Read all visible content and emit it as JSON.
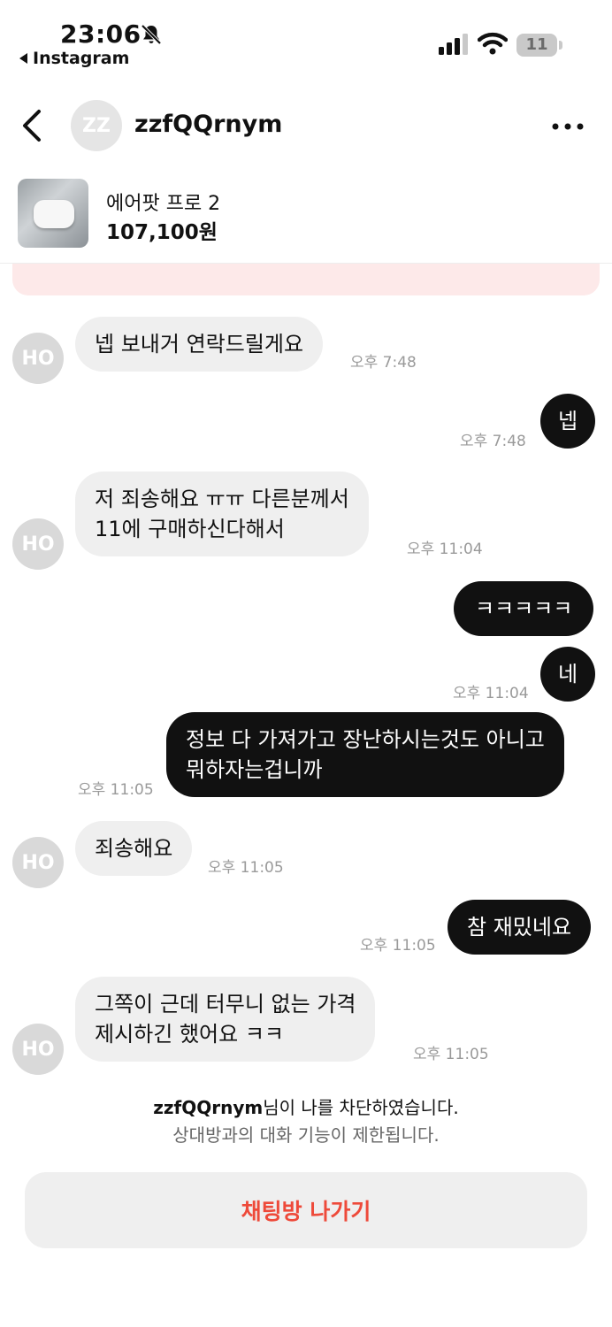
{
  "status_bar": {
    "time": "23:06",
    "back_app": "Instagram",
    "battery": "11"
  },
  "header": {
    "avatar_initials": "ZZ",
    "username": "zzfQQrnym"
  },
  "product": {
    "name": "에어팟 프로 2",
    "price": "107,100원"
  },
  "messages": [
    {
      "dir": "in",
      "avatar": "HO",
      "lines": [
        "넵 보내거 연락드릴게요"
      ],
      "time": "오후 7:48"
    },
    {
      "dir": "out",
      "lines": [
        "넵"
      ],
      "time": "오후 7:48"
    },
    {
      "dir": "in",
      "avatar": "HO",
      "lines": [
        "저 죄송해요 ㅠㅠ 다른분께서",
        "11에 구매하신다해서"
      ],
      "time": "오후 11:04"
    },
    {
      "dir": "out",
      "lines": [
        "ㅋㅋㅋㅋㅋ"
      ],
      "time": ""
    },
    {
      "dir": "out",
      "lines": [
        "네"
      ],
      "time": "오후 11:04"
    },
    {
      "dir": "out",
      "lines": [
        "정보 다 가져가고 장난하시는것도 아니고",
        "뭐하자는겁니까"
      ],
      "time": "오후 11:05"
    },
    {
      "dir": "in",
      "avatar": "HO",
      "lines": [
        "죄송해요"
      ],
      "time": "오후 11:05"
    },
    {
      "dir": "out",
      "lines": [
        "참 재밌네요"
      ],
      "time": "오후 11:05"
    },
    {
      "dir": "in",
      "avatar": "HO",
      "lines": [
        "그쪽이 근데 터무니 없는 가격",
        "제시하긴 했어요 ㅋㅋ"
      ],
      "time": "오후 11:05"
    }
  ],
  "footer": {
    "blocked_name": "zzfQQrnym",
    "blocked_suffix": "님이 나를 차단하였습니다.",
    "restricted": "상대방과의 대화 기능이 제한됩니다.",
    "leave_button": "채팅방 나가기"
  }
}
